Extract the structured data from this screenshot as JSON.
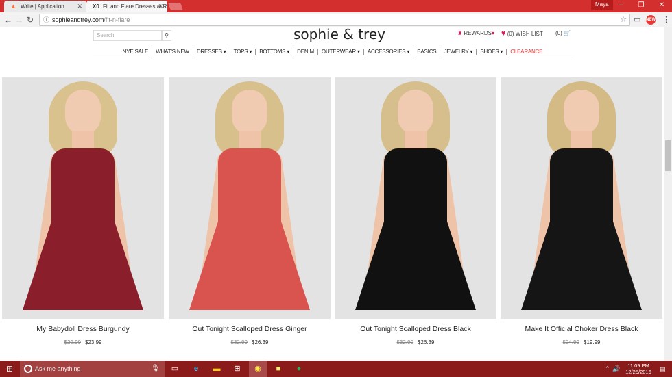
{
  "browser": {
    "tabs": [
      {
        "title": "Write | Application",
        "icon": "flame-icon"
      },
      {
        "title": "Fit and Flare Dresses at R",
        "icon": "st-logo-icon"
      }
    ],
    "user": "Maya",
    "url_domain": "sophieandtrey.com",
    "url_path": "/fit-n-flare",
    "extension_badge": "NEW"
  },
  "site": {
    "logo": "sophie & trey",
    "search_placeholder": "Search",
    "rewards_label": "REWARDS",
    "wishlist_label": "(0) WISH LIST",
    "cart_label": "(0)",
    "nav": [
      {
        "label": "NYE SALE"
      },
      {
        "label": "WHAT'S NEW"
      },
      {
        "label": "DRESSES ▾"
      },
      {
        "label": "TOPS ▾"
      },
      {
        "label": "BOTTOMS ▾"
      },
      {
        "label": "DENIM"
      },
      {
        "label": "OUTERWEAR ▾"
      },
      {
        "label": "ACCESSORIES ▾"
      },
      {
        "label": "BASICS"
      },
      {
        "label": "JEWELRY ▾"
      },
      {
        "label": "SHOES ▾"
      },
      {
        "label": "CLEARANCE",
        "color": "#e53935"
      }
    ]
  },
  "products": [
    {
      "name": "My Babydoll Dress Burgundy",
      "old_price": "$29.99",
      "price": "$23.99",
      "dress_color": "#8b1e2b",
      "hair_color": "#d9c28e"
    },
    {
      "name": "Out Tonight Scalloped Dress Ginger",
      "old_price": "$32.99",
      "price": "$26.39",
      "dress_color": "#d9534f",
      "hair_color": "#d8c08c"
    },
    {
      "name": "Out Tonight Scalloped Dress Black",
      "old_price": "$32.99",
      "price": "$26.39",
      "dress_color": "#111111",
      "hair_color": "#d6bf8d"
    },
    {
      "name": "Make It Official Choker Dress Black",
      "old_price": "$24.99",
      "price": "$19.99",
      "dress_color": "#151515",
      "hair_color": "#d4bb86"
    }
  ],
  "taskbar": {
    "search_placeholder": "Ask me anything",
    "time": "11:09 PM",
    "date": "12/25/2016"
  }
}
